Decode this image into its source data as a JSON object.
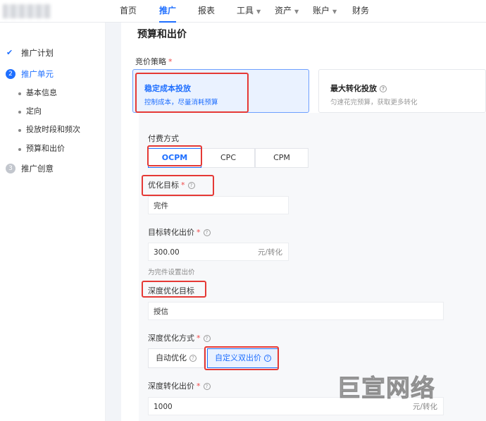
{
  "nav": {
    "items": [
      {
        "label": "首页",
        "active": false,
        "caret": false
      },
      {
        "label": "推广",
        "active": true,
        "caret": false
      },
      {
        "label": "报表",
        "active": false,
        "caret": false
      },
      {
        "label": "工具",
        "active": false,
        "caret": true
      },
      {
        "label": "资产",
        "active": false,
        "caret": true
      },
      {
        "label": "账户",
        "active": false,
        "caret": true
      },
      {
        "label": "财务",
        "active": false,
        "caret": false
      }
    ],
    "caret_icon": "chevron-down-icon"
  },
  "sidebar": {
    "steps": [
      {
        "label": "推广计划",
        "state": "done",
        "icon": "check-icon"
      },
      {
        "label": "推广单元",
        "state": "current",
        "number": "2"
      },
      {
        "label": "推广创意",
        "state": "pending",
        "number": "3"
      }
    ],
    "sub_items": [
      "基本信息",
      "定向",
      "投放时段和频次",
      "预算和出价"
    ]
  },
  "main": {
    "title": "预算和出价",
    "strategy": {
      "label": "竞价策略",
      "required_mark": "*",
      "options": [
        {
          "title": "稳定成本投放",
          "subtitle": "控制成本，尽量消耗预算",
          "selected": true
        },
        {
          "title": "最大转化投放",
          "subtitle": "匀速花完预算，获取更多转化",
          "selected": false
        }
      ]
    },
    "billing": {
      "label": "付费方式",
      "options": [
        "OCPM",
        "CPC",
        "CPM"
      ],
      "selected": "OCPM"
    },
    "optimize_goal": {
      "label": "优化目标",
      "required_mark": "*",
      "value": "完件"
    },
    "target_bid": {
      "label": "目标转化出价",
      "required_mark": "*",
      "value": "300.00",
      "unit": "元/转化",
      "hint": "为完件设置出价"
    },
    "deep_goal": {
      "label": "深度优化目标",
      "value": "授信"
    },
    "deep_mode": {
      "label": "深度优化方式",
      "required_mark": "*",
      "options": [
        "自动优化",
        "自定义双出价"
      ],
      "selected": "自定义双出价"
    },
    "deep_bid": {
      "label": "深度转化出价",
      "required_mark": "*",
      "value": "1000",
      "unit": "元/转化"
    }
  },
  "watermark": "巨宣网络",
  "colors": {
    "accent": "#1f6fff",
    "highlight_box": "#e53935",
    "required": "#f04848"
  }
}
